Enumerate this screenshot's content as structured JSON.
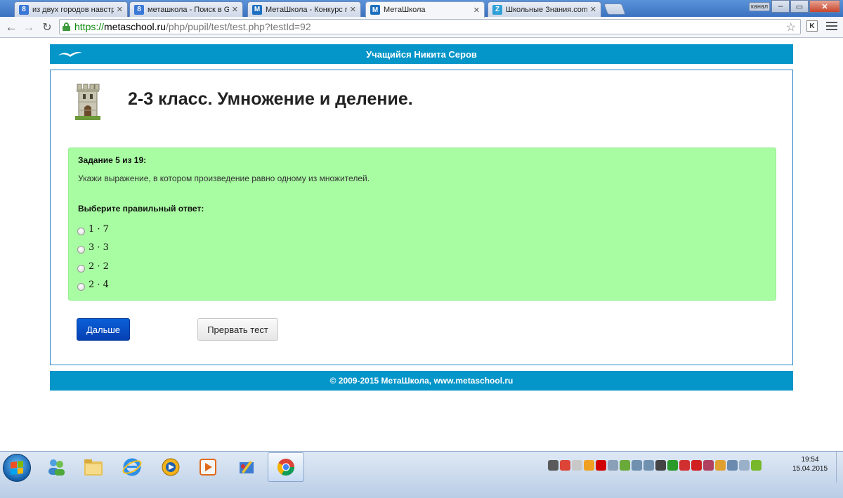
{
  "browser": {
    "tabs": [
      {
        "title": "из двух городов навстре",
        "favicon": "8",
        "favicon_color": "#3a78d6",
        "active": false
      },
      {
        "title": "меташкола - Поиск в Goo",
        "favicon": "8",
        "favicon_color": "#3a78d6",
        "active": false
      },
      {
        "title": "МетаШкола - Конкурс по",
        "favicon": "M",
        "favicon_color": "#1d6fc0",
        "active": false
      },
      {
        "title": "МетаШкола",
        "favicon": "M",
        "favicon_color": "#1d6fc0",
        "active": true
      },
      {
        "title": "Школьные Знания.com -",
        "favicon": "Z",
        "favicon_color": "#2fa0d8",
        "active": false
      }
    ],
    "profile_label": "канал",
    "url_scheme": "https://",
    "url_host": "metaschool.ru",
    "url_path": "/php/pupil/test/test.php?testId=92",
    "ext_label": "K"
  },
  "page": {
    "header_text": "Учащийся Никита Серов",
    "title": "2-3 класс. Умножение и деление.",
    "task": {
      "number_label": "Задание 5 из 19:",
      "question": "Укажи выражение, в котором произведение равно одному из множителей.",
      "choose_label": "Выберите правильный ответ:",
      "options": [
        "1 · 7",
        "3 · 3",
        "2 · 2",
        "2 · 4"
      ]
    },
    "next_button": "Дальше",
    "abort_button": "Прервать тест",
    "footer_text": "© 2009-2015 МетаШкола, www.metaschool.ru"
  },
  "taskbar": {
    "time": "19:54",
    "date": "15.04.2015"
  },
  "colors": {
    "brand_blue": "#0495c9",
    "task_green": "#a8fca2",
    "next_button": "#0540b2"
  }
}
